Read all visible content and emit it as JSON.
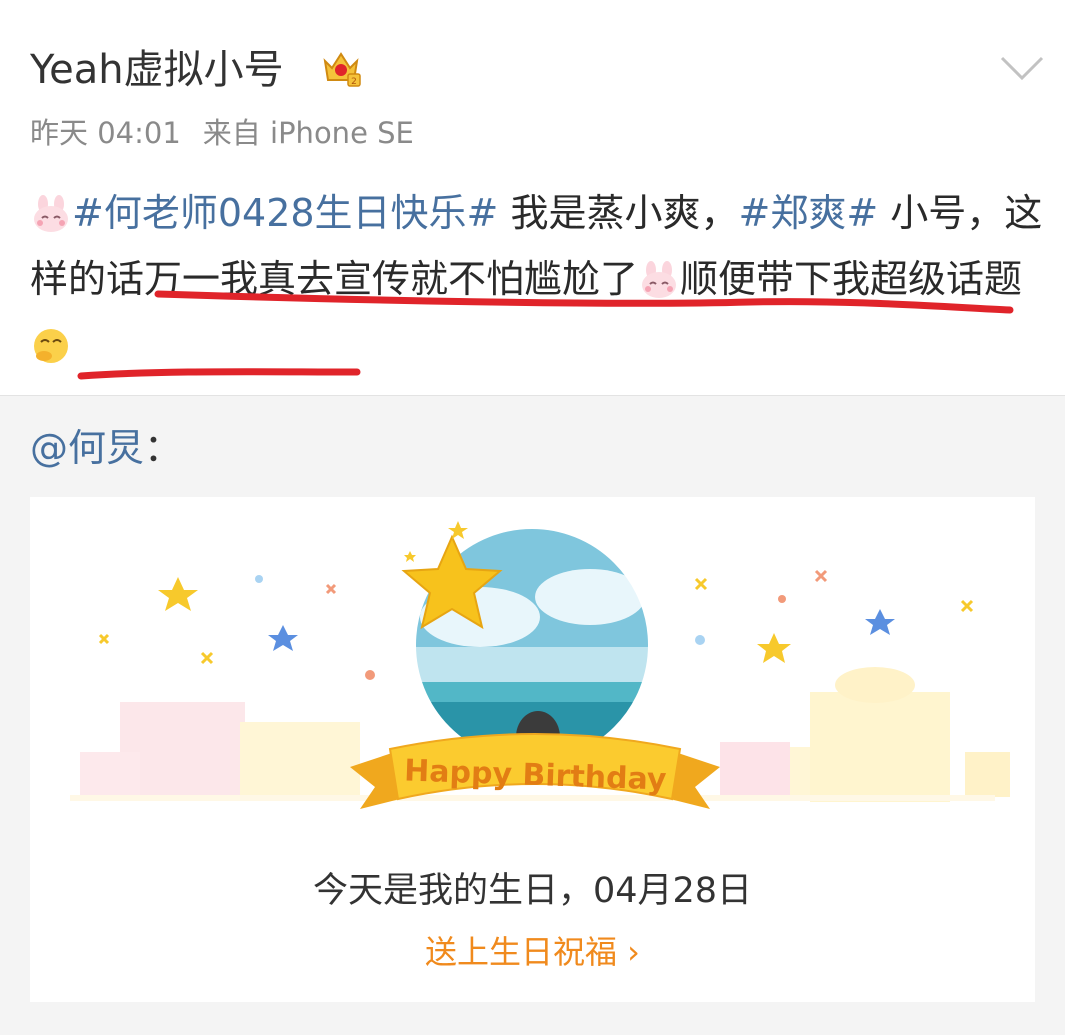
{
  "post": {
    "username": "Yeah虚拟小号",
    "time": "昨天 04:01",
    "source": "来自 iPhone SE",
    "content": {
      "tag1": "#何老师0428生日快乐#",
      "text1": " 我是蒸小爽，",
      "tag2": "#郑爽#",
      "text2": " 小号，这样的话万一我真去宣传就不怕尴尬了",
      "text3": "顺便带下我超级话题"
    },
    "icons": {
      "vip_badge": "crown-icon",
      "more": "chevron-down-icon",
      "emoji_1": "rabbit-emoji",
      "emoji_2": "rabbit-emoji",
      "emoji_3": "thinking-emoji"
    },
    "colors": {
      "tag": "#47709f",
      "underline": "#e0242a",
      "link": "#f08a1d"
    }
  },
  "repost": {
    "mention": "@何炅",
    "colon": "：",
    "card": {
      "banner": "Happy Birthday",
      "line": "今天是我的生日，04月28日",
      "link": "送上生日祝福 ›"
    }
  }
}
